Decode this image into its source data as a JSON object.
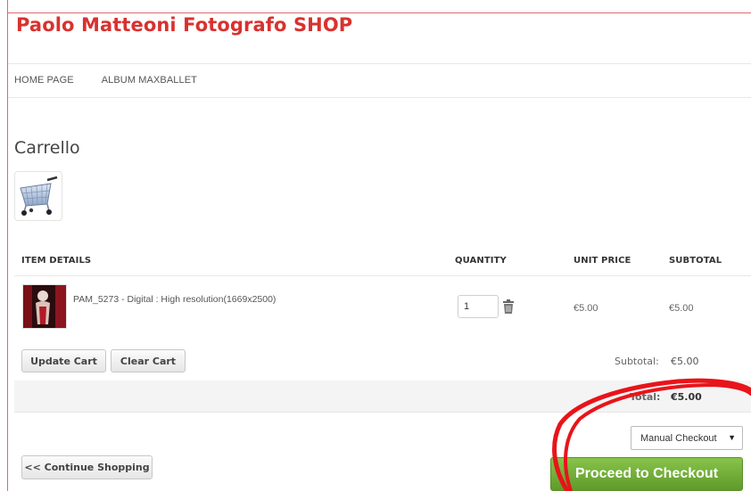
{
  "site": {
    "title": "Paolo Matteoni Fotografo SHOP"
  },
  "nav": {
    "items": [
      {
        "label": "HOME PAGE"
      },
      {
        "label": "ALBUM MAXBALLET"
      }
    ]
  },
  "page": {
    "title": "Carrello"
  },
  "table": {
    "headers": {
      "item_details": "ITEM DETAILS",
      "quantity": "QUANTITY",
      "unit_price": "UNIT PRICE",
      "subtotal": "SUBTOTAL"
    },
    "rows": [
      {
        "name": "PAM_5273 - Digital : High resolution(1669x2500)",
        "quantity": "1",
        "unit_price": "€5.00",
        "subtotal": "€5.00"
      }
    ]
  },
  "buttons": {
    "update_cart": "Update Cart",
    "clear_cart": "Clear Cart",
    "continue_shopping": "<< Continue Shopping",
    "proceed_checkout": "Proceed to Checkout"
  },
  "summary": {
    "subtotal_label": "Subtotal:",
    "subtotal_value": "€5.00",
    "total_label": "Total:",
    "total_value": "€5.00"
  },
  "checkout_method": {
    "selected": "Manual Checkout"
  },
  "icons": {
    "cart": "shopping-cart-icon",
    "trash": "trash-icon",
    "caret": "caret-down-icon"
  },
  "colors": {
    "brand": "#d8322f",
    "checkout": "#6fab35",
    "annotation": "#e8141a"
  }
}
